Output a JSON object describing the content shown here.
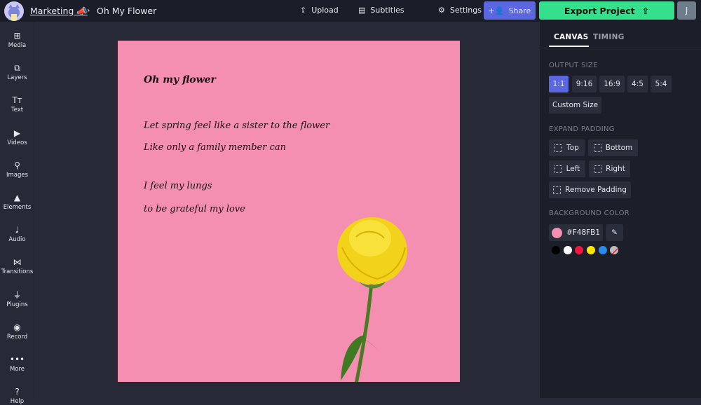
{
  "header": {
    "breadcrumb": "Marketing 📣",
    "project_title": "Oh My Flower",
    "upload": "Upload",
    "subtitles": "Subtitles",
    "settings": "Settings",
    "share": "Share",
    "export": "Export Project",
    "user_initial": "J"
  },
  "sidebar": {
    "items": [
      {
        "label": "Media",
        "icon": "⊞"
      },
      {
        "label": "Layers",
        "icon": "⧉"
      },
      {
        "label": "Text",
        "icon": "Tт"
      },
      {
        "label": "Videos",
        "icon": "▶"
      },
      {
        "label": "Images",
        "icon": "⚲"
      },
      {
        "label": "Elements",
        "icon": "▲"
      },
      {
        "label": "Audio",
        "icon": "♩"
      },
      {
        "label": "Transitions",
        "icon": "⋈"
      },
      {
        "label": "Plugins",
        "icon": "⏚"
      },
      {
        "label": "Record",
        "icon": "◉"
      },
      {
        "label": "More",
        "icon": "•••"
      },
      {
        "label": "Help",
        "icon": "?"
      }
    ]
  },
  "canvas": {
    "background": "#F48FB1",
    "title": "Oh my flower",
    "lines": [
      "Let spring feel like a sister to the flower",
      "Like only a family member can",
      "I feel my lungs",
      "to be grateful my love"
    ]
  },
  "panel": {
    "tabs": [
      "CANVAS",
      "TIMING"
    ],
    "output_size_label": "OUTPUT SIZE",
    "sizes": [
      "1:1",
      "9:16",
      "16:9",
      "4:5",
      "5:4"
    ],
    "selected_size": "1:1",
    "custom_size": "Custom Size",
    "expand_padding_label": "EXPAND PADDING",
    "padding": [
      "Top",
      "Bottom",
      "Left",
      "Right",
      "Remove Padding"
    ],
    "bg_color_label": "BACKGROUND COLOR",
    "bg_color": "#F48FB1",
    "swatches": [
      "#000000",
      "#ffffff",
      "#f0163f",
      "#ffe500",
      "#2a8be8"
    ]
  }
}
